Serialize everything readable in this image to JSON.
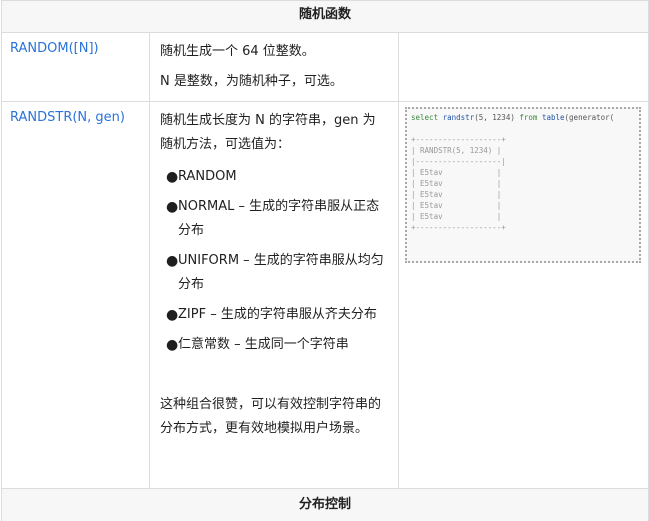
{
  "headers": {
    "top": "随机函数",
    "bottom": "分布控制"
  },
  "rows": [
    {
      "name": "RANDOM([N])",
      "desc_lines": [
        "随机生成一个 64 位整数。",
        "N 是整数，为随机种子，可选。"
      ]
    },
    {
      "name": "RANDSTR(N, gen)",
      "intro": "随机生成长度为 N 的字符串，gen 为随机方法，可选值为：",
      "bullets": [
        "RANDOM",
        "NORMAL – 生成的字符串服从正态分布",
        "UNIFORM – 生成的字符串服从均匀分布",
        "ZIPF – 生成的字符串服从齐夫分布",
        "仁意常数 – 生成同一个字符串"
      ],
      "closing": "这种组合很赞，可以有效控制字符串的分布方式，更有效地模拟用户场景。"
    }
  ],
  "code": {
    "query": {
      "kw_select": "select",
      "fn": "randstr",
      "args": "(5, 1234)",
      "kw_from": "from",
      "fn_table": "table",
      "rest": "(generator("
    },
    "result_lines": [
      "+-------------------+",
      "| RANDSTR(5, 1234) |",
      "|-------------------|",
      "| E5tav            |",
      "| E5tav            |",
      "| E5tav            |",
      "| E5tav            |",
      "| E5tav            |",
      "+-------------------+"
    ]
  }
}
